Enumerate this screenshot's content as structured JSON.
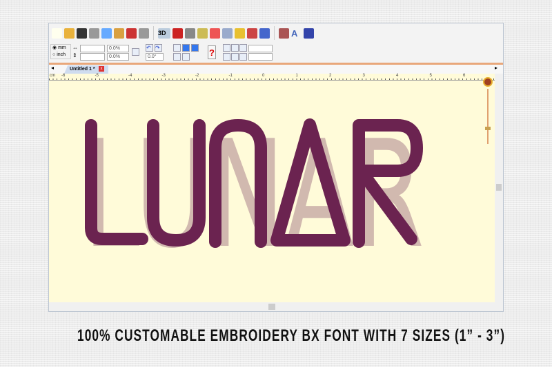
{
  "toolbar": {
    "icons": [
      "new-file-icon",
      "open-folder-icon",
      "save-icon",
      "print-icon",
      "copy-icon",
      "paste-icon",
      "undo-stitch-icon",
      "redo-stitch-icon",
      "3d-view-icon",
      "color-view-icon",
      "zoom-icon",
      "ruler-icon",
      "center-icon",
      "select-icon",
      "thread-chart-icon",
      "needle-icon",
      "pattern-icon",
      "settings-icon",
      "text-tool-icon",
      "export-icon"
    ],
    "label_3d": "3D",
    "text_tool": "A"
  },
  "units": {
    "mm": "mm",
    "inch": "inch",
    "selected": "mm"
  },
  "fields": {
    "width": "",
    "height": "",
    "scale_x": "0.0%",
    "scale_y": "0.0%",
    "rotation": "0.0°",
    "spacing_x": "",
    "spacing_y": ""
  },
  "help_icon": "?",
  "tab": {
    "label": "Untitled 1 *"
  },
  "ruler": {
    "unit": "cm",
    "labels": [
      "-6",
      "-5",
      "-4",
      "-3",
      "-2",
      "-1",
      "0",
      "1",
      "2",
      "3",
      "4",
      "5",
      "6"
    ]
  },
  "design": {
    "text": "LUNAR",
    "thread_color": "#6b2350"
  },
  "canvas_color": "#fffbd9",
  "caption": "100% CUSTOMABLE EMBROIDERY BX FONT WITH 7 SIZES (1” -  3”)"
}
